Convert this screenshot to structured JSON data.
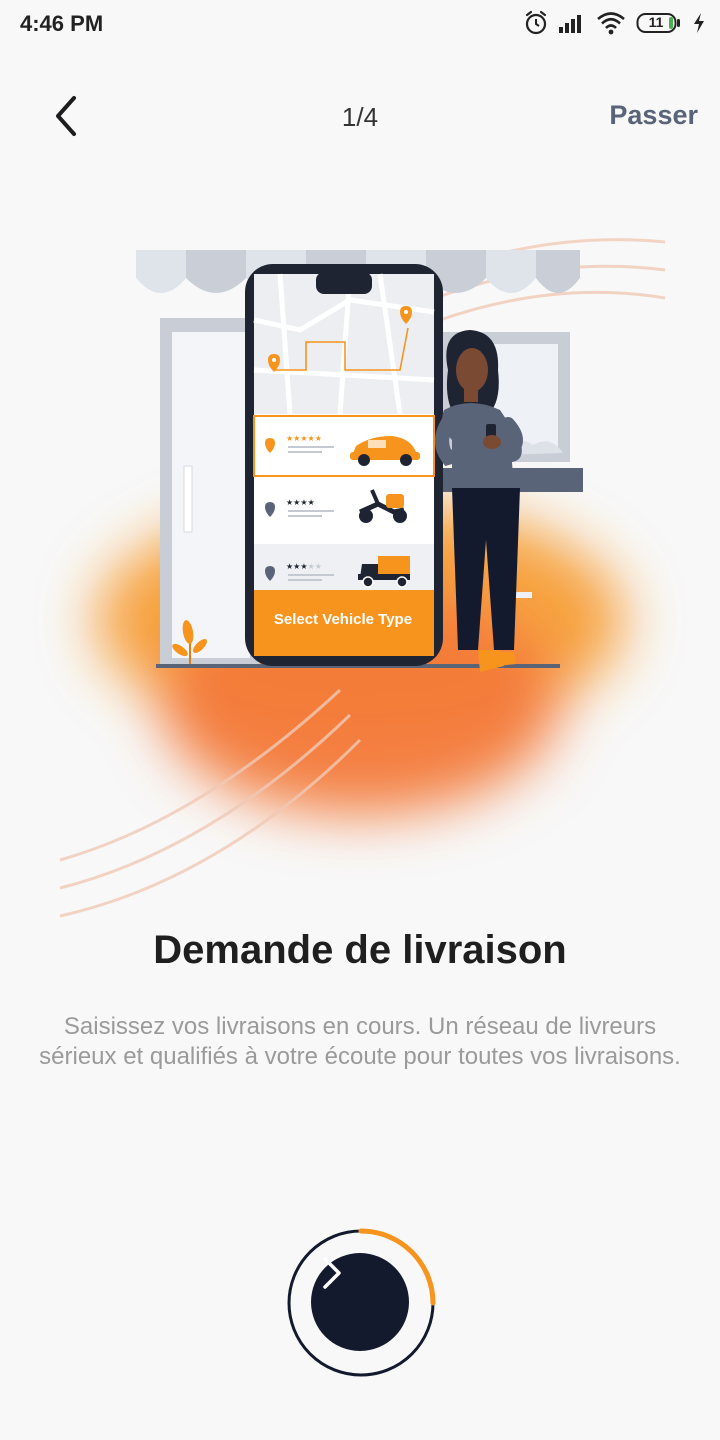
{
  "status_bar": {
    "time": "4:46 PM",
    "battery_level": "11",
    "icons": [
      "alarm-icon",
      "signal-icon",
      "wifi-icon",
      "battery-icon",
      "charging-icon"
    ]
  },
  "nav": {
    "back_icon": "chevron-left-icon",
    "step": "1/4",
    "skip_label": "Passer"
  },
  "illustration": {
    "select_button_label": "Select Vehicle Type",
    "vehicle_options": [
      {
        "vehicle": "car",
        "rating": 5,
        "selected": true
      },
      {
        "vehicle": "scooter",
        "rating": 4,
        "selected": false
      },
      {
        "vehicle": "truck",
        "rating": 3,
        "selected": false
      }
    ]
  },
  "slide": {
    "title": "Demande de livraison",
    "description": "Saisissez vos livraisons en cours. Un réseau de livreurs sérieux et qualifiés à votre écoute pour toutes vos livraisons."
  },
  "next": {
    "icon": "chevron-right-icon",
    "progress": 0.25
  },
  "colors": {
    "accent": "#f7941d",
    "dark": "#141a2e",
    "skip": "#5a6478"
  }
}
